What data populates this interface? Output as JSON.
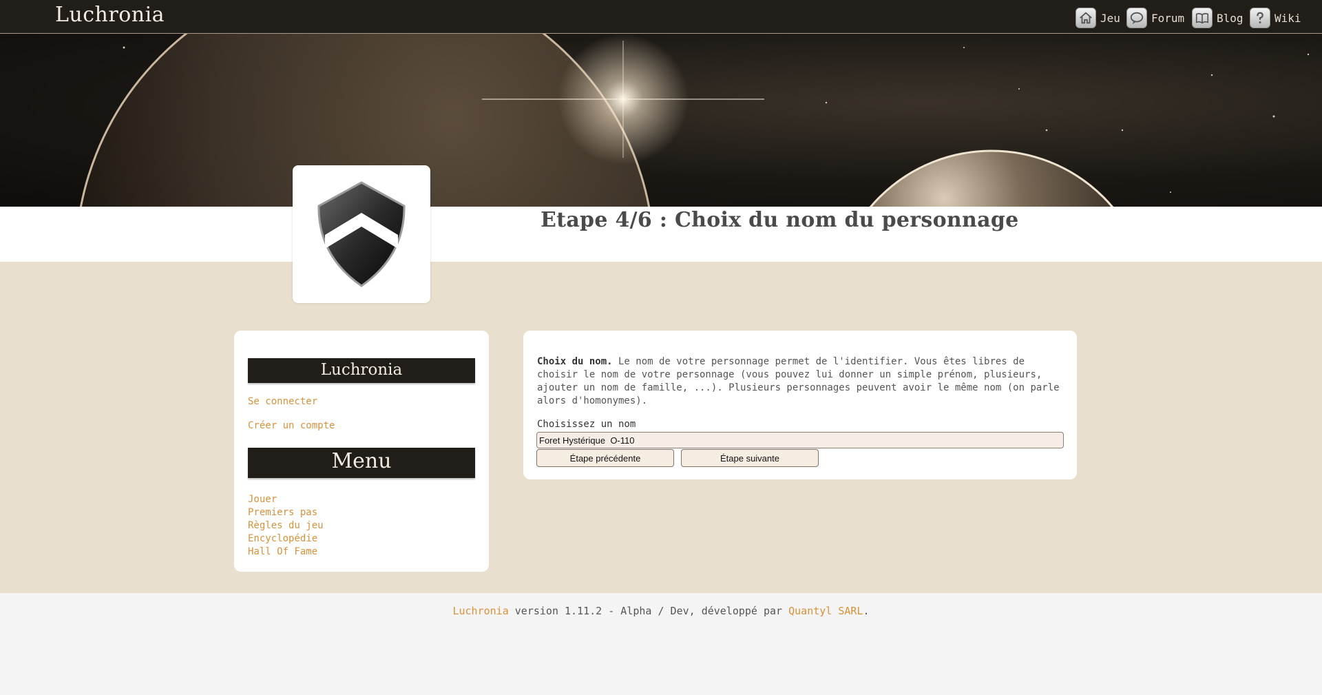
{
  "header": {
    "brand": "Luchronia",
    "nav": [
      {
        "label": "Jeu",
        "icon": "home-icon"
      },
      {
        "label": "Forum",
        "icon": "speech-bubble-icon"
      },
      {
        "label": "Blog",
        "icon": "book-icon"
      },
      {
        "label": "Wiki",
        "icon": "question-icon"
      }
    ]
  },
  "page": {
    "title": "Etape 4/6 : Choix du nom du personnage"
  },
  "sidebar": {
    "account_heading": "Luchronia",
    "login_link": "Se connecter",
    "register_link": "Créer un compte",
    "menu_heading": "Menu",
    "menu_items": [
      "Jouer",
      "Premiers pas",
      "Règles du jeu",
      "Encyclopédie",
      "Hall Of Fame"
    ]
  },
  "form": {
    "intro_bold": "Choix du nom.",
    "intro_text": " Le nom de votre personnage permet de l'identifier. Vous êtes libres de choisir le nom de votre personnage (vous pouvez lui donner un simple prénom, plusieurs, ajouter un nom de famille, ...). Plusieurs personnages peuvent avoir le même nom (on parle alors d'homonymes).",
    "name_label": "Choisissez un nom",
    "name_value": "Foret Hystérique  O-110",
    "prev_label": "Étape précédente",
    "next_label": "Étape suivante"
  },
  "footer": {
    "app_link": "Luchronia",
    "version_text": " version 1.11.2 - Alpha / Dev, développé par ",
    "company_link": "Quantyl SARL",
    "end": "."
  },
  "colors": {
    "topbar": "#211d18",
    "main_background": "#e9dfcf",
    "link": "#d9913a"
  }
}
